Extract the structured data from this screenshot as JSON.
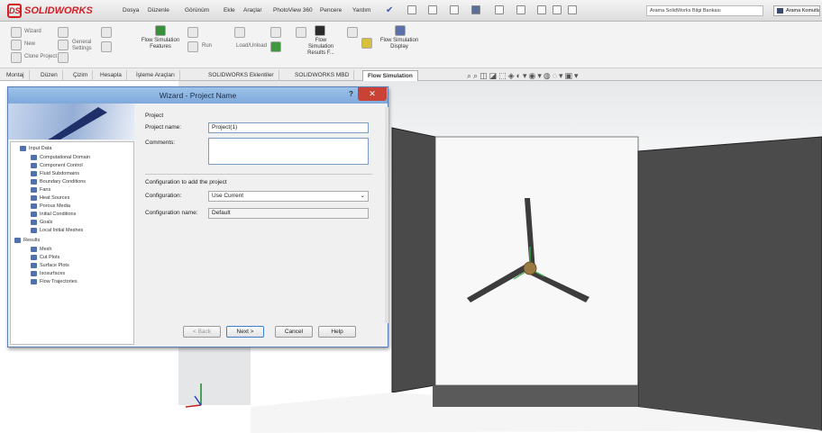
{
  "app": {
    "name": "SOLIDWORKS"
  },
  "menubar": [
    "Dosya",
    "Düzenle",
    "Görünüm",
    "Ekle",
    "Araçlar",
    "PhotoView 360",
    "Pencere",
    "Yardım"
  ],
  "search": {
    "placeholder": "Arama SolidWorks Bilgi Bankası"
  },
  "search_button": "Arama Komutları",
  "ribbon": {
    "small": [
      "Wizard",
      "New",
      "Clone Project",
      "General Settings",
      "Load/Unload"
    ],
    "buttons": [
      "Flow Simulation Features",
      "Run",
      "Flow Simulation Results F...",
      "Flow Simulation Display"
    ]
  },
  "tabs": [
    "Montaj",
    "Düzen",
    "Çizim",
    "Hesapla",
    "İşleme Araçları",
    "SOLIDWORKS Eklentiler",
    "SOLIDWORKS MBD",
    "Flow Simulation"
  ],
  "dialog": {
    "title": "Wizard - Project Name",
    "help": "?",
    "close": "✕",
    "tree": [
      "Input Data",
      "Computational Domain",
      "Component Control",
      "Fluid Subdomains",
      "Boundary Conditions",
      "Fans",
      "Heat Sources",
      "Porous Media",
      "Initial Conditions",
      "Goals",
      "Local Initial Meshes",
      "Results",
      "Mesh",
      "Cut Plots",
      "Surface Plots",
      "Isosurfaces",
      "Flow Trajectories"
    ],
    "project_heading": "Project",
    "project_name_label": "Project name:",
    "project_name_value": "Project(1)",
    "comments_label": "Comments:",
    "config_heading": "Configuration to add the project",
    "configuration_label": "Configuration:",
    "configuration_value": "Use Current",
    "config_name_label": "Configuration name:",
    "config_name_value": "Default",
    "buttons": {
      "back": "< Back",
      "next": "Next >",
      "cancel": "Cancel",
      "help": "Help"
    }
  },
  "colors": {
    "accent": "#d21f26",
    "dialog_title": "#8ab3e1",
    "box": "#404040",
    "turbine_hub": "#9a7a40"
  }
}
